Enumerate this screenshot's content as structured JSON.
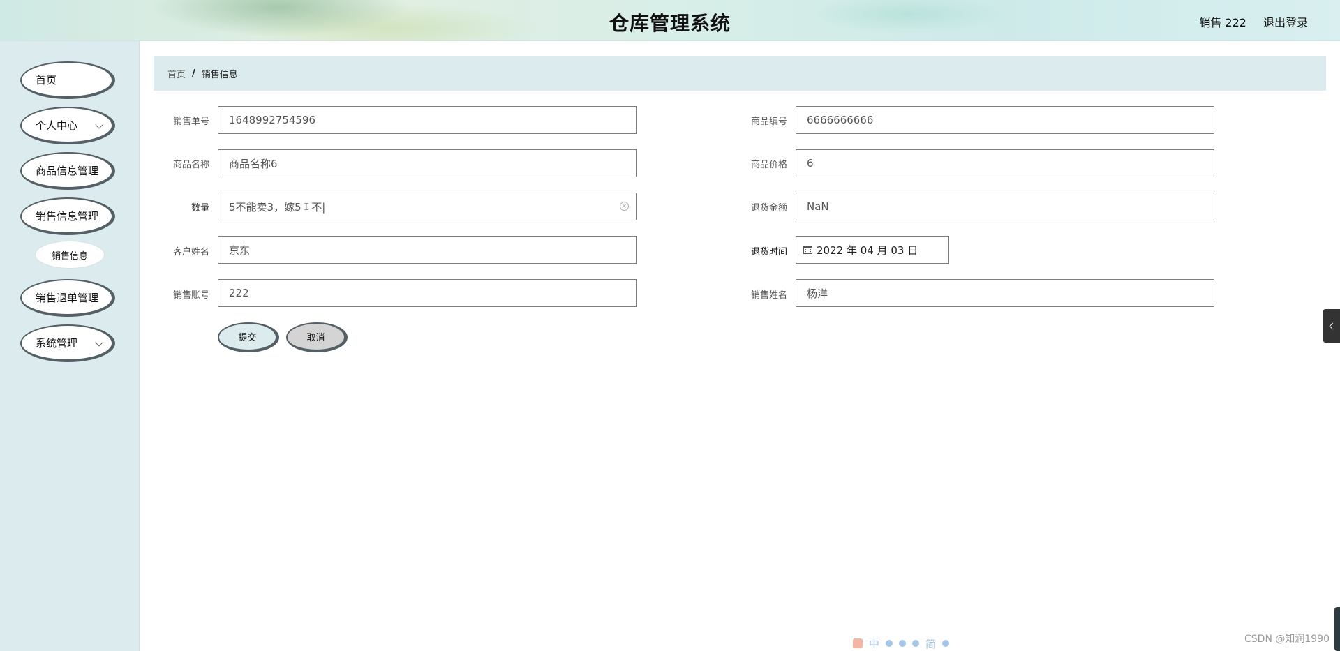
{
  "header": {
    "title": "仓库管理系统",
    "user_label": "销售 222",
    "logout_label": "退出登录"
  },
  "sidebar": {
    "items": [
      {
        "label": "首页"
      },
      {
        "label": "个人中心"
      },
      {
        "label": "商品信息管理"
      },
      {
        "label": "销售信息管理"
      },
      {
        "label": "销售信息"
      },
      {
        "label": "销售退单管理"
      },
      {
        "label": "系统管理"
      }
    ]
  },
  "breadcrumb": {
    "home": "首页",
    "separator": "/",
    "current": "销售信息"
  },
  "form": {
    "sale_no": {
      "label": "销售单号",
      "value": "1648992754596"
    },
    "product_code": {
      "label": "商品编号",
      "value": "6666666666"
    },
    "product_name": {
      "label": "商品名称",
      "value": "商品名称6"
    },
    "product_price": {
      "label": "商品价格",
      "value": "6"
    },
    "quantity": {
      "label": "数量",
      "value_before_cursor": "5不能卖3，嫁5",
      "value_after_cursor": "不|"
    },
    "refund_amount": {
      "label": "退货金额",
      "value": "NaN"
    },
    "customer_name": {
      "label": "客户姓名",
      "value": "京东"
    },
    "refund_time": {
      "label": "退货时间",
      "value": "2022 年 04 月 03 日"
    },
    "sales_account": {
      "label": "销售账号",
      "value": "222"
    },
    "sales_name": {
      "label": "销售姓名",
      "value": "杨洋"
    },
    "submit_label": "提交",
    "cancel_label": "取消"
  },
  "footer": {
    "ime_glyph_1": "中",
    "ime_glyph_2": "简",
    "watermark": "CSDN @知润1990"
  },
  "icons": {
    "menu_expand": "chevron-down-icon",
    "clear": "clear-circle-icon",
    "calendar": "calendar-icon",
    "side_toggle": "chevron-left-icon"
  }
}
